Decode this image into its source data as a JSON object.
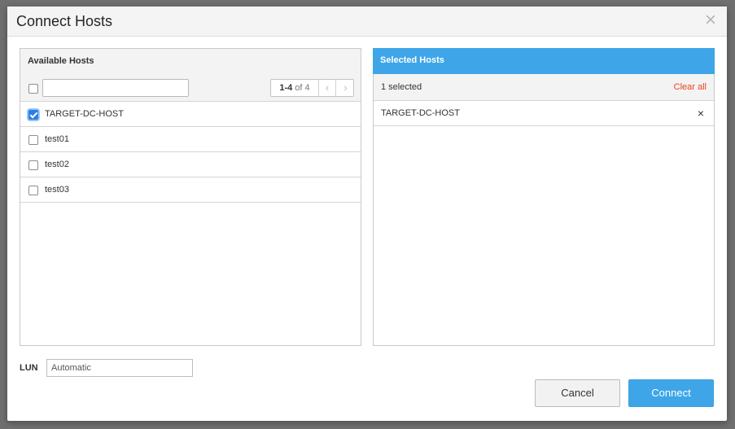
{
  "dialog": {
    "title": "Connect Hosts",
    "close_icon": "×"
  },
  "available": {
    "title": "Available Hosts",
    "search_value": "",
    "pager": {
      "range": "1-4",
      "of_text": " of 4",
      "prev_icon": "‹",
      "next_icon": "›"
    },
    "hosts": [
      {
        "name": "TARGET-DC-HOST",
        "checked": true
      },
      {
        "name": "test01",
        "checked": false
      },
      {
        "name": "test02",
        "checked": false
      },
      {
        "name": "test03",
        "checked": false
      }
    ]
  },
  "selected": {
    "title": "Selected Hosts",
    "count_text": "1 selected",
    "clear_all": "Clear all",
    "hosts": [
      {
        "name": "TARGET-DC-HOST",
        "remove_icon": "×"
      }
    ]
  },
  "lun": {
    "label": "LUN",
    "placeholder": "Automatic"
  },
  "buttons": {
    "cancel": "Cancel",
    "connect": "Connect"
  },
  "colors": {
    "accent": "#3ea6e8",
    "danger": "#e8441c",
    "checkbox": "#2b7de9"
  }
}
